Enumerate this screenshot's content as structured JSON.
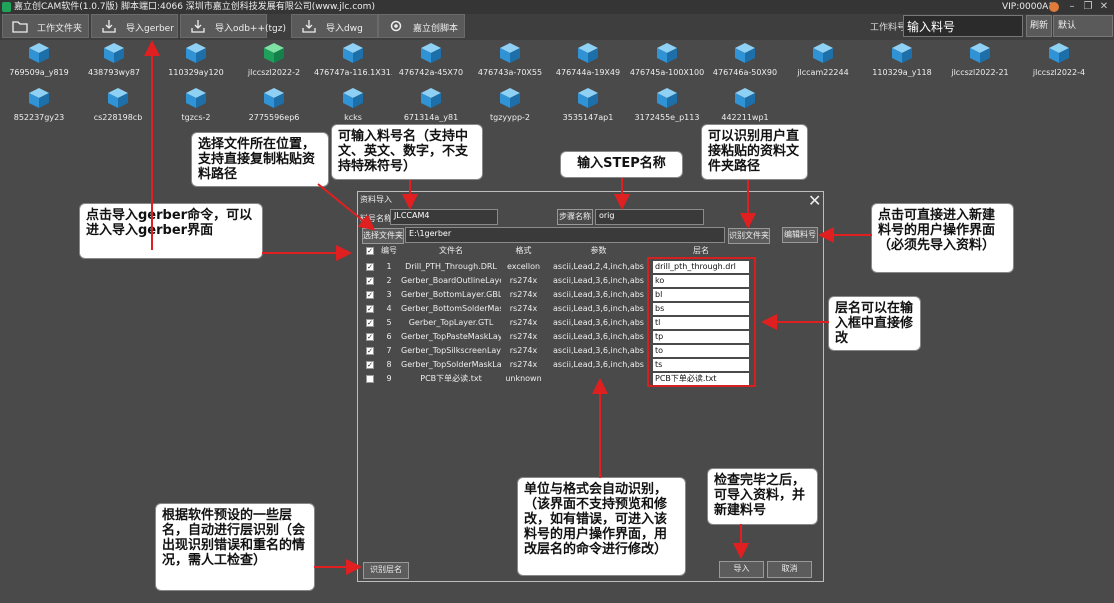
{
  "window": {
    "title": "嘉立创CAM软件(1.0.7版) 脚本端口:4066 深圳市嘉立创科技发展有限公司(www.jlc.com)",
    "vip": "VIP:0000A1"
  },
  "toolbar": {
    "buttons": [
      {
        "label": "工作文件夹",
        "icon": "folder-icon"
      },
      {
        "label": "导入gerber",
        "icon": "import-icon"
      },
      {
        "label": "导入odb++(tgz)",
        "icon": "import-icon"
      },
      {
        "label": "导入dwg",
        "icon": "import-icon"
      },
      {
        "label": "嘉立创脚本",
        "icon": "gear-icon"
      }
    ],
    "job_label": "工作料号:",
    "job_value": "输入料号",
    "refresh": "刷新",
    "default": "默认"
  },
  "files": [
    "769509a_y819",
    "438793wy87",
    "110329ay120",
    "jlccszl2022-2",
    "476747a-116.1X31...",
    "476742a-45X70",
    "476743a-70X55",
    "476744a-19X49",
    "476745a-100X100",
    "476746a-50X90",
    "jlccam22244",
    "110329a_y118",
    "jlccszl2022-21",
    "jlccszl2022-4",
    "852237gy23",
    "cs228198cb",
    "tgzcs-2",
    "2775596ep6",
    "kcks",
    "671314a_y81",
    "tgzyypp-2",
    "3535147ap1",
    "3172455e_p113",
    "442211wp1"
  ],
  "dialog": {
    "title": "资料导入",
    "name_label": "料号名称:",
    "name_value": "JLCCAM4",
    "step_label": "步骤名称",
    "step_value": "orig",
    "choose_folder": "选择文件夹",
    "path_value": "E:\\1gerber",
    "identify_folder": "识别文件夹",
    "edit_job": "编辑料号",
    "headers": {
      "index": "编号",
      "filename": "文件名",
      "format": "格式",
      "params": "参数",
      "layer": "层名"
    },
    "rows": [
      {
        "checked": true,
        "index": "1",
        "filename": "Drill_PTH_Through.DRL",
        "format": "excellon",
        "params": "ascii,Lead,2,4,inch,abs",
        "layer": "drill_pth_through.drl"
      },
      {
        "checked": true,
        "index": "2",
        "filename": "Gerber_BoardOutlineLayer...",
        "format": "rs274x",
        "params": "ascii,Lead,3,6,inch,abs",
        "layer": "ko"
      },
      {
        "checked": true,
        "index": "3",
        "filename": "Gerber_BottomLayer.GBL",
        "format": "rs274x",
        "params": "ascii,Lead,3,6,inch,abs",
        "layer": "bl"
      },
      {
        "checked": true,
        "index": "4",
        "filename": "Gerber_BottomSolderMas...",
        "format": "rs274x",
        "params": "ascii,Lead,3,6,inch,abs",
        "layer": "bs"
      },
      {
        "checked": true,
        "index": "5",
        "filename": "Gerber_TopLayer.GTL",
        "format": "rs274x",
        "params": "ascii,Lead,3,6,inch,abs",
        "layer": "tl"
      },
      {
        "checked": true,
        "index": "6",
        "filename": "Gerber_TopPasteMaskLay...",
        "format": "rs274x",
        "params": "ascii,Lead,3,6,inch,abs",
        "layer": "tp"
      },
      {
        "checked": true,
        "index": "7",
        "filename": "Gerber_TopSilkscreenLaye...",
        "format": "rs274x",
        "params": "ascii,Lead,3,6,inch,abs",
        "layer": "to"
      },
      {
        "checked": true,
        "index": "8",
        "filename": "Gerber_TopSolderMaskLa...",
        "format": "rs274x",
        "params": "ascii,Lead,3,6,inch,abs",
        "layer": "ts"
      },
      {
        "checked": false,
        "index": "9",
        "filename": "PCB下单必读.txt",
        "format": "unknown",
        "params": "",
        "layer": "PCB下单必读.txt"
      }
    ],
    "identify_layers": "识别层名",
    "import": "导入",
    "cancel": "取消"
  },
  "callouts": {
    "c1": "选择文件所在位置，支持直接复制粘贴资料路径",
    "c2": "可输入料号名（支持中文、英文、数字，不支持特殊符号）",
    "c3": "输入STEP名称",
    "c4": "可以识别用户直接粘贴的资料文件夹路径",
    "c5": "点击导入gerber命令，可以进入导入gerber界面",
    "c6": "点击可直接进入新建料号的用户操作界面（必须先导入资料）",
    "c7": "层名可以在输入框中直接修改",
    "c8": "单位与格式会自动识别，（该界面不支持预览和修改，如有错误，可进入该料号的用户操作界面，用改层名的命令进行修改）",
    "c9": "检查完毕之后，可导入资料，并新建料号",
    "c10": "根据软件预设的一些层名，自动进行层识别（会出现识别错误和重名的情况，需人工检查）"
  }
}
